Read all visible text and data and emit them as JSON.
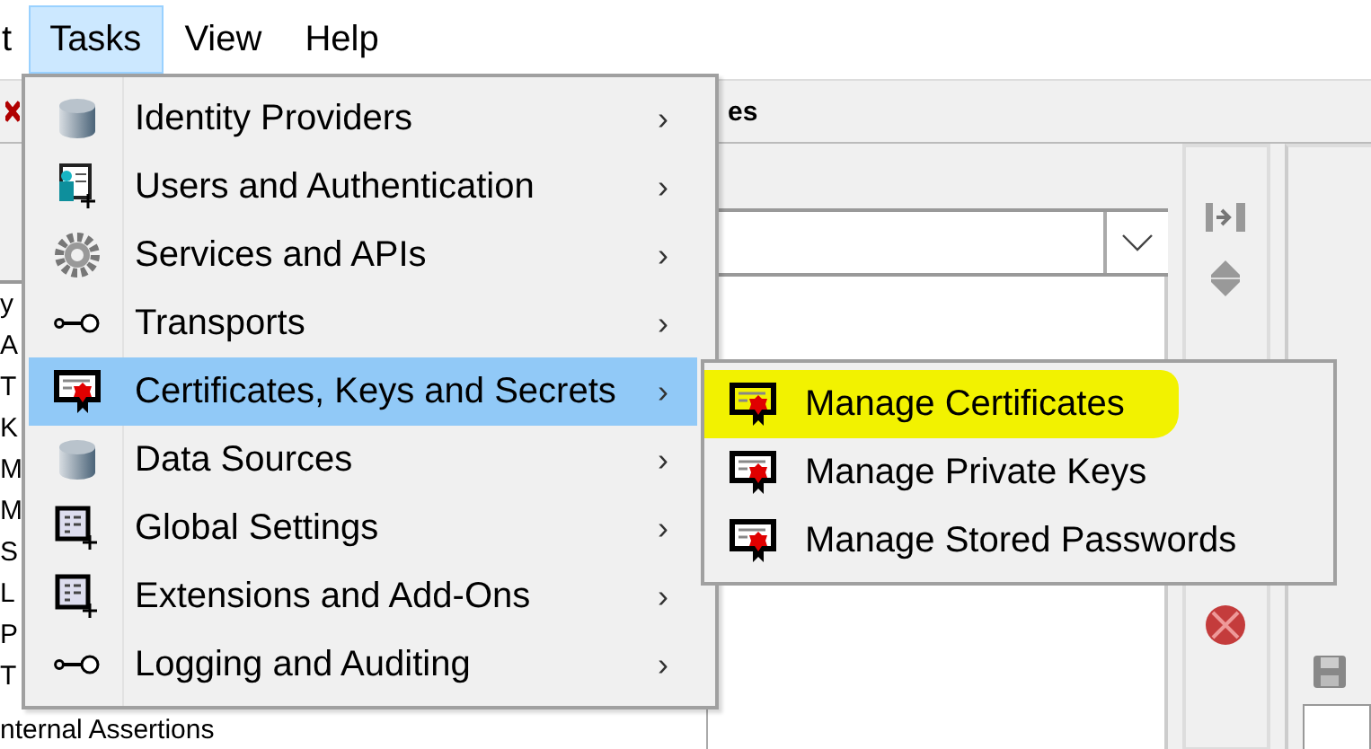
{
  "menu_bar": [
    {
      "label": "t",
      "selected": false
    },
    {
      "label": "Tasks",
      "selected": true
    },
    {
      "label": "View",
      "selected": false
    },
    {
      "label": "Help",
      "selected": false
    }
  ],
  "toolbar": {
    "tab_label": "es"
  },
  "left_list": [
    "y",
    "A",
    "T",
    "K",
    "M",
    "M",
    "S",
    "L",
    "P",
    "T",
    "nternal Assertions"
  ],
  "tasks_menu": [
    {
      "label": "Identity Providers",
      "kind": "database",
      "arrow": "›",
      "selected": false
    },
    {
      "label": "Users and Authentication",
      "kind": "users",
      "arrow": "›",
      "selected": false
    },
    {
      "label": "Services and APIs",
      "kind": "gear",
      "arrow": "›",
      "selected": false
    },
    {
      "label": "Transports",
      "kind": "connector",
      "arrow": "›",
      "selected": false
    },
    {
      "label": "Certificates, Keys and Secrets",
      "kind": "certificate",
      "arrow": "›",
      "selected": true
    },
    {
      "label": "Data Sources",
      "kind": "database",
      "arrow": "›",
      "selected": false
    },
    {
      "label": "Global Settings",
      "kind": "grid",
      "arrow": "›",
      "selected": false
    },
    {
      "label": "Extensions and Add-Ons",
      "kind": "grid",
      "arrow": "›",
      "selected": false
    },
    {
      "label": "Logging and Auditing",
      "kind": "connector",
      "arrow": "›",
      "selected": false
    }
  ],
  "submenu": [
    {
      "label": "Manage Certificates",
      "highlighted": true
    },
    {
      "label": "Manage Private Keys",
      "highlighted": false
    },
    {
      "label": "Manage Stored Passwords",
      "highlighted": false
    }
  ]
}
